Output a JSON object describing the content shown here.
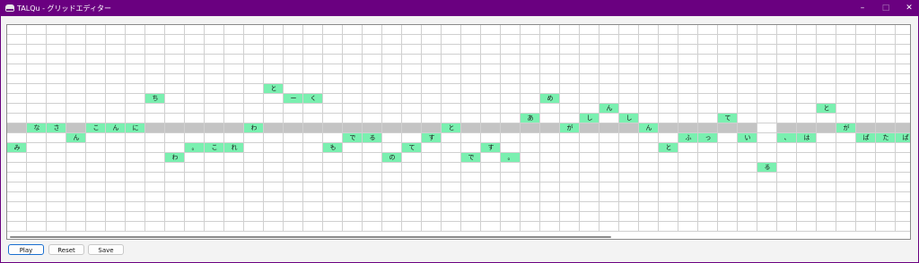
{
  "window": {
    "title": "TALQu - グリッドエディター",
    "controls": {
      "minimize": "–",
      "maximize": "□",
      "close": "✕"
    }
  },
  "grid": {
    "cols": 46,
    "rows": 21,
    "baseline_row": 10,
    "baseline_skip_cols": [
      38
    ],
    "cells": [
      {
        "row": 6,
        "col": 13,
        "text": "と"
      },
      {
        "row": 7,
        "col": 7,
        "text": "ち"
      },
      {
        "row": 7,
        "col": 14,
        "text": "ー"
      },
      {
        "row": 7,
        "col": 15,
        "text": "く"
      },
      {
        "row": 7,
        "col": 27,
        "text": "め"
      },
      {
        "row": 8,
        "col": 30,
        "text": "ん"
      },
      {
        "row": 8,
        "col": 41,
        "text": "と"
      },
      {
        "row": 9,
        "col": 26,
        "text": "あ"
      },
      {
        "row": 9,
        "col": 29,
        "text": "し"
      },
      {
        "row": 9,
        "col": 31,
        "text": "し"
      },
      {
        "row": 9,
        "col": 36,
        "text": "て"
      },
      {
        "row": 10,
        "col": 1,
        "text": "な"
      },
      {
        "row": 10,
        "col": 2,
        "text": "さ"
      },
      {
        "row": 10,
        "col": 4,
        "text": "こ"
      },
      {
        "row": 10,
        "col": 5,
        "text": "ん"
      },
      {
        "row": 10,
        "col": 6,
        "text": "に"
      },
      {
        "row": 10,
        "col": 12,
        "text": "わ"
      },
      {
        "row": 10,
        "col": 22,
        "text": "と"
      },
      {
        "row": 10,
        "col": 28,
        "text": "が"
      },
      {
        "row": 10,
        "col": 32,
        "text": "ん"
      },
      {
        "row": 10,
        "col": 42,
        "text": "が"
      },
      {
        "row": 11,
        "col": 3,
        "text": "ん"
      },
      {
        "row": 11,
        "col": 17,
        "text": "で"
      },
      {
        "row": 11,
        "col": 18,
        "text": "る"
      },
      {
        "row": 11,
        "col": 21,
        "text": "す"
      },
      {
        "row": 11,
        "col": 34,
        "text": "ふ"
      },
      {
        "row": 11,
        "col": 35,
        "text": "っ"
      },
      {
        "row": 11,
        "col": 37,
        "text": "い"
      },
      {
        "row": 11,
        "col": 39,
        "text": "、"
      },
      {
        "row": 11,
        "col": 40,
        "text": "は"
      },
      {
        "row": 11,
        "col": 43,
        "text": "ぱ"
      },
      {
        "row": 11,
        "col": 44,
        "text": "た"
      },
      {
        "row": 11,
        "col": 45,
        "text": "ぱ"
      },
      {
        "row": 12,
        "col": 0,
        "text": "み"
      },
      {
        "row": 12,
        "col": 9,
        "text": "。"
      },
      {
        "row": 12,
        "col": 10,
        "text": "こ"
      },
      {
        "row": 12,
        "col": 11,
        "text": "れ"
      },
      {
        "row": 12,
        "col": 16,
        "text": "も"
      },
      {
        "row": 12,
        "col": 20,
        "text": "て"
      },
      {
        "row": 12,
        "col": 24,
        "text": "す"
      },
      {
        "row": 12,
        "col": 33,
        "text": "と"
      },
      {
        "row": 13,
        "col": 8,
        "text": "わ"
      },
      {
        "row": 13,
        "col": 19,
        "text": "の"
      },
      {
        "row": 13,
        "col": 23,
        "text": "で"
      },
      {
        "row": 13,
        "col": 25,
        "text": "。"
      },
      {
        "row": 14,
        "col": 38,
        "text": "る"
      }
    ]
  },
  "buttons": {
    "play": "Play",
    "reset": "Reset",
    "save": "Save"
  },
  "colors": {
    "titlebar": "#6a0080",
    "note_cell": "#7af0b0",
    "baseline_row": "#c4c4c4",
    "grid_line": "#d0d0d0",
    "play_border": "#1a6fd0"
  }
}
